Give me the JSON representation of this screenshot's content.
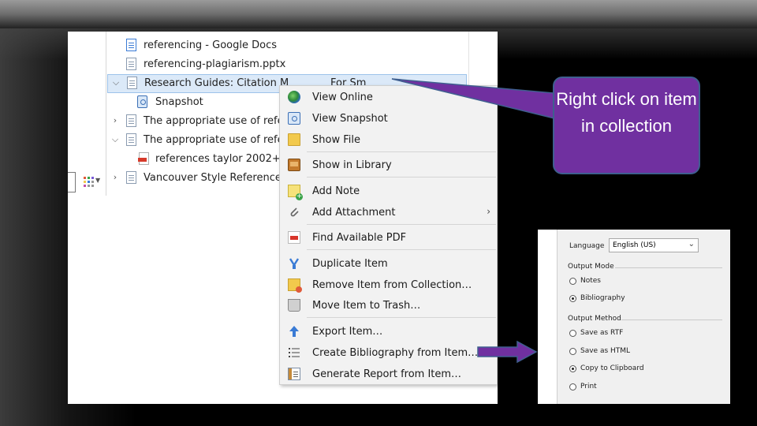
{
  "items": [
    {
      "label": "referencing - Google Docs",
      "icon": "google-doc-icon",
      "dot": false
    },
    {
      "label": "referencing-plagiarism.pptx",
      "icon": "document-icon",
      "dot": true
    },
    {
      "label": "Research Guides: Citation M",
      "icon": "document-icon",
      "dot": true,
      "selected": true
    },
    {
      "label": "Snapshot",
      "icon": "snapshot-icon",
      "child": true
    },
    {
      "label": "The appropriate use of refe",
      "icon": "document-icon"
    },
    {
      "label": "The appropriate use of refe",
      "icon": "document-icon"
    },
    {
      "label": "references taylor 2002+.p",
      "icon": "pdf-icon",
      "child": true
    },
    {
      "label": "Vancouver Style Reference",
      "icon": "document-icon"
    }
  ],
  "selected_trailing_text": "For Sm",
  "menu": {
    "view_online": "View Online",
    "view_snapshot": "View Snapshot",
    "show_file": "Show File",
    "show_in_library": "Show in Library",
    "add_note": "Add Note",
    "add_attachment": "Add Attachment",
    "find_available_pdf": "Find Available PDF",
    "duplicate_item": "Duplicate Item",
    "remove_from_collection": "Remove Item from Collection…",
    "move_to_trash": "Move Item to Trash…",
    "export_item": "Export Item…",
    "create_bibliography": "Create Bibliography from Item…",
    "generate_report": "Generate Report from Item…"
  },
  "callout": {
    "text": "Right click on item in collection",
    "fill": "#7030a0"
  },
  "options": {
    "language_label": "Language",
    "language_value": "English (US)",
    "output_mode_label": "Output Mode",
    "mode_notes": "Notes",
    "mode_bibliography": "Bibliography",
    "output_method_label": "Output Method",
    "method_rtf": "Save as RTF",
    "method_html": "Save as HTML",
    "method_clipboard": "Copy to Clipboard",
    "method_print": "Print"
  },
  "colors": {
    "accent_purple": "#7030a0",
    "selection": "#dbe9f8"
  }
}
